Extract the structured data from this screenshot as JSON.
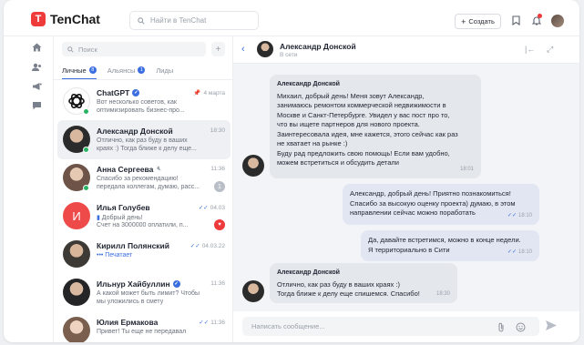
{
  "app": {
    "logo_letter": "T",
    "name": "TenChat"
  },
  "topbar": {
    "search_placeholder": "Найти в TenChat",
    "create_label": "Создать"
  },
  "sidebar": {
    "search_placeholder": "Поиск",
    "add_label": "+",
    "tabs": [
      {
        "label": "Личные",
        "badge": "8"
      },
      {
        "label": "Альянсы",
        "badge": "1"
      },
      {
        "label": "Лиды",
        "badge": ""
      }
    ],
    "chats": [
      {
        "name": "ChatGPT",
        "line1": "Вот несколько советов, как",
        "line2": "оптимизировать бизнес-про...",
        "time": "4 марта",
        "unread": ""
      },
      {
        "name": "Александр Донской",
        "line1": "Отлично, как раз буду в ваших",
        "line2": "краях :) Тогда ближе к делу еще...",
        "time": "18:30",
        "unread": ""
      },
      {
        "name": "Анна Сергеева",
        "line1": "Спасибо за рекомендацию!",
        "line2": "передала коллегам, думаю, расс...",
        "time": "11:36",
        "unread": "1"
      },
      {
        "name": "Илья Голубев",
        "line1": "Добрый день!",
        "line2": "Счет на 3000000 оплатили, п...",
        "time": "04.03",
        "unread": "♥"
      },
      {
        "name": "Кирилл Полянский",
        "line1": "Печатает",
        "line2": "",
        "time": "04.03.22",
        "unread": ""
      },
      {
        "name": "Ильнур Хайбуллин",
        "line1": "А какой может быть лимит? Чтобы",
        "line2": "мы уложились в смету",
        "time": "11:36",
        "unread": ""
      },
      {
        "name": "Юлия Ермакова",
        "line1": "Привет! Ты еще не передавал",
        "line2": "",
        "time": "11:36",
        "unread": ""
      }
    ]
  },
  "chat": {
    "name": "Александр Донской",
    "status": "В сети",
    "messages": [
      {
        "author": "Александр Донской",
        "lines": [
          "Михаил, добрый день! Меня зовут Александр,",
          "занимаюсь ремонтом коммерческой недвижимости в",
          "Москве и Санкт-Петербурге. Увидел у вас пост про то,",
          "что вы ищете партнеров для нового проекта.",
          "Заинтересовала идея, мне кажется, этого сейчас как раз",
          "не хватает на рынке :)",
          "Буду рад предложить свою помощь! Если вам удобно,",
          "можем встретиться и обсудить детали"
        ],
        "time": "18:01"
      },
      {
        "author": "",
        "lines": [
          "Александр, добрый день! Приятно познакомиться!",
          "Спасибо за высокую оценку проекта) думаю, в этом",
          "направлении сейчас можно поработать"
        ],
        "time": "18:10"
      },
      {
        "author": "",
        "lines": [
          "Да, давайте встретимся, можно в конце недели.",
          "Я территориально в Сити"
        ],
        "time": "18:10"
      },
      {
        "author": "Александр Донской",
        "lines": [
          "Отлично, как раз буду в ваших краях :)",
          "Тогда ближе к делу еще спишемся. Спасибо!"
        ],
        "time": "18:30"
      }
    ],
    "composer_placeholder": "Написать сообщение..."
  },
  "colors": {
    "accent": "#3b6fe0",
    "brand": "#ee3a3a",
    "online": "#28b463"
  },
  "icons": [
    "search-icon",
    "bookmark-icon",
    "bell-icon",
    "home-icon",
    "people-icon",
    "megaphone-icon",
    "chat-icon",
    "pin-icon",
    "mute-icon",
    "attach-icon",
    "emoji-icon",
    "send-icon"
  ]
}
